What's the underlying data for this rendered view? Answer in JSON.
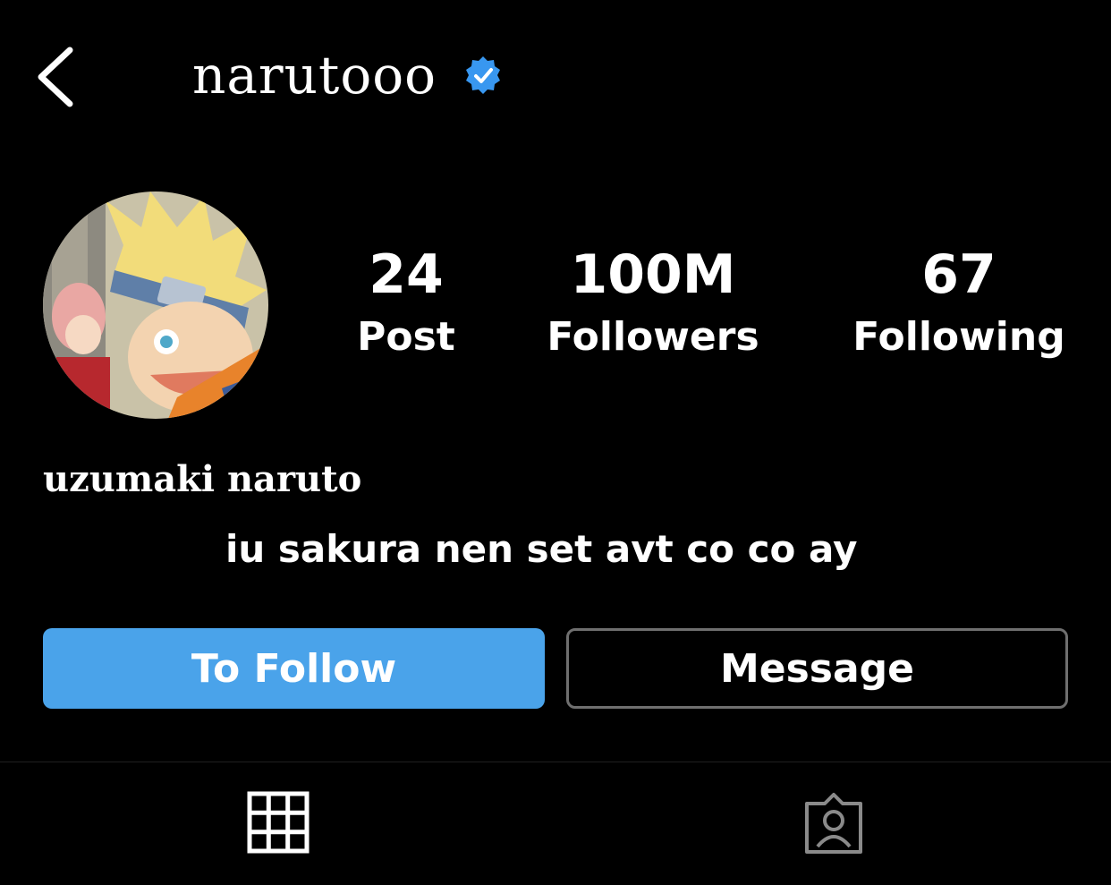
{
  "header": {
    "username": "narutooo",
    "icons": {
      "back": "chevron-left-icon",
      "verified": "verified-badge-icon"
    }
  },
  "profile": {
    "avatar": "avatar",
    "stats": [
      {
        "value": "24",
        "label": "Post"
      },
      {
        "value": "100M",
        "label": "Followers"
      },
      {
        "value": "67",
        "label": "Following"
      }
    ],
    "full_name": "uzumaki naruto",
    "bio": "iu sakura nen set avt co co ay"
  },
  "actions": {
    "follow_label": "To Follow",
    "message_label": "Message"
  },
  "tabs": [
    {
      "icon": "grid-icon"
    },
    {
      "icon": "tagged-person-icon"
    }
  ],
  "colors": {
    "background": "#000000",
    "accent": "#4aa3ea",
    "verified": "#3897f0",
    "button_border": "#6f6f6f"
  }
}
